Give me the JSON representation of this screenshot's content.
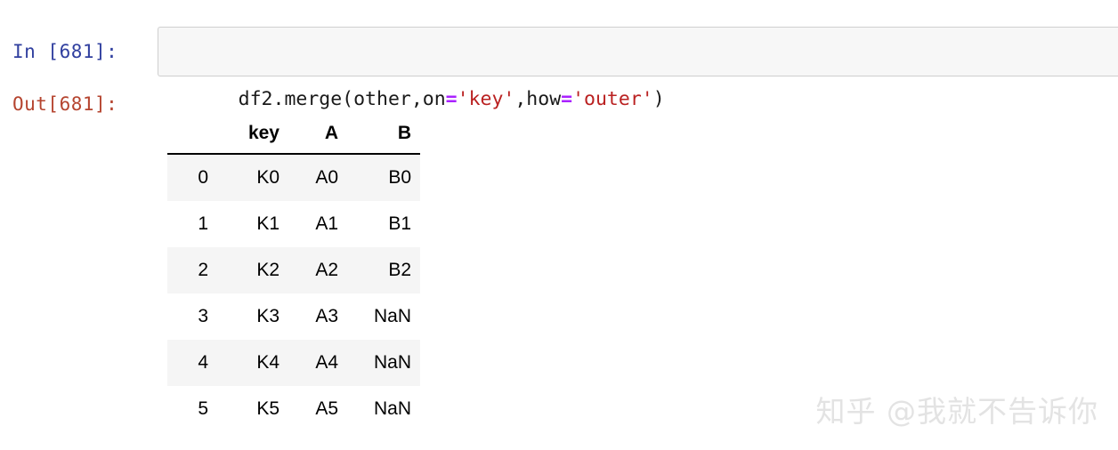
{
  "notebook": {
    "input_prompt": "In [681]:",
    "output_prompt": "Out[681]:",
    "code": {
      "full": "df2.merge(other,on='key',how='outer')",
      "tokens": [
        {
          "text": "df2.merge(other,on",
          "type": "plain"
        },
        {
          "text": "=",
          "type": "operator"
        },
        {
          "text": "'key'",
          "type": "string"
        },
        {
          "text": ",how",
          "type": "plain"
        },
        {
          "text": "=",
          "type": "operator"
        },
        {
          "text": "'outer'",
          "type": "string"
        },
        {
          "text": ")",
          "type": "plain"
        }
      ]
    }
  },
  "dataframe": {
    "index_header": "",
    "columns": [
      "key",
      "A",
      "B"
    ],
    "index": [
      "0",
      "1",
      "2",
      "3",
      "4",
      "5"
    ],
    "rows": [
      {
        "index": "0",
        "key": "K0",
        "A": "A0",
        "B": "B0"
      },
      {
        "index": "1",
        "key": "K1",
        "A": "A1",
        "B": "B1"
      },
      {
        "index": "2",
        "key": "K2",
        "A": "A2",
        "B": "B2"
      },
      {
        "index": "3",
        "key": "K3",
        "A": "A3",
        "B": "NaN"
      },
      {
        "index": "4",
        "key": "K4",
        "A": "A4",
        "B": "NaN"
      },
      {
        "index": "5",
        "key": "K5",
        "A": "A5",
        "B": "NaN"
      }
    ]
  },
  "watermark": {
    "text": "知乎 @我就不告诉你"
  },
  "colors": {
    "in_prompt": "#303f9f",
    "out_prompt": "#b5442f",
    "code_operator": "#aa22ff",
    "code_string": "#ba2121",
    "input_cell_bg": "#f7f7f7",
    "input_cell_border": "#cfcfcf",
    "row_stripe": "#f5f5f5",
    "watermark": "#e3e3e3"
  }
}
